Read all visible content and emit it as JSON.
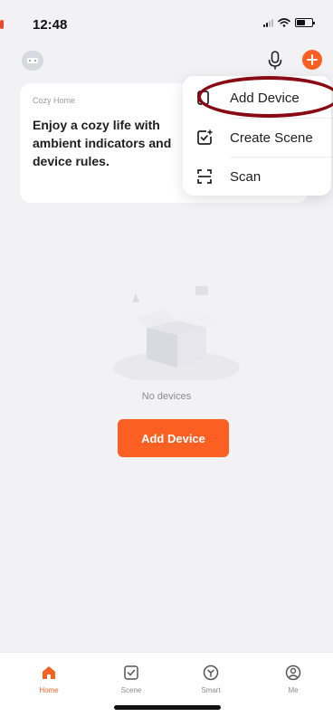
{
  "status_bar": {
    "time": "12:48"
  },
  "cozy_card": {
    "label": "Cozy Home",
    "description": "Enjoy a cozy life with ambient indicators and device rules."
  },
  "dropdown": {
    "items": [
      {
        "label": "Add Device",
        "icon": "add-device-icon"
      },
      {
        "label": "Create Scene",
        "icon": "create-scene-icon"
      },
      {
        "label": "Scan",
        "icon": "scan-icon"
      }
    ]
  },
  "empty_state": {
    "message": "No devices",
    "button_label": "Add Device"
  },
  "tab_bar": {
    "tabs": [
      {
        "label": "Home",
        "icon": "home-icon",
        "active": true
      },
      {
        "label": "Scene",
        "icon": "scene-icon",
        "active": false
      },
      {
        "label": "Smart",
        "icon": "smart-icon",
        "active": false
      },
      {
        "label": "Me",
        "icon": "me-icon",
        "active": false
      }
    ]
  },
  "colors": {
    "accent": "#fb5f22",
    "highlight_ring": "#8a0a14",
    "background": "#f2f2f5"
  }
}
